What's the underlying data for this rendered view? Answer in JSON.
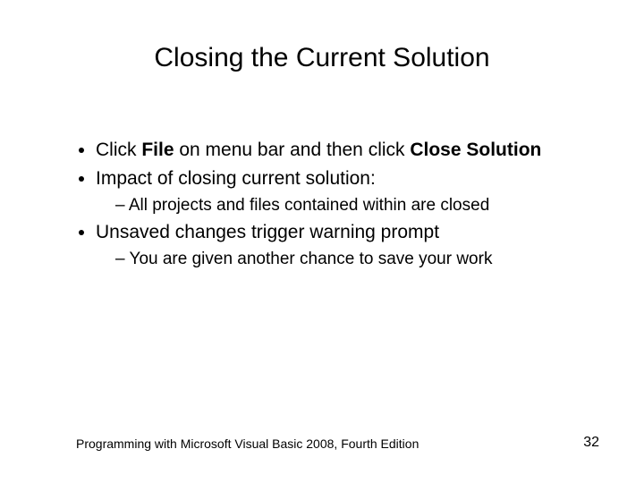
{
  "slide": {
    "title": "Closing the Current Solution",
    "bullets": [
      {
        "runs": [
          {
            "t": "Click "
          },
          {
            "t": "File",
            "b": true
          },
          {
            "t": " on menu bar and then click "
          },
          {
            "t": "Close Solution",
            "b": true
          }
        ]
      },
      {
        "runs": [
          {
            "t": "Impact of closing current solution:"
          }
        ],
        "sub": [
          "All projects and files contained within are closed"
        ]
      },
      {
        "runs": [
          {
            "t": "Unsaved changes trigger warning prompt"
          }
        ],
        "sub": [
          "You are given another chance to save your work"
        ]
      }
    ],
    "footer_left": "Programming with Microsoft Visual Basic 2008, Fourth Edition",
    "page_number": "32"
  }
}
